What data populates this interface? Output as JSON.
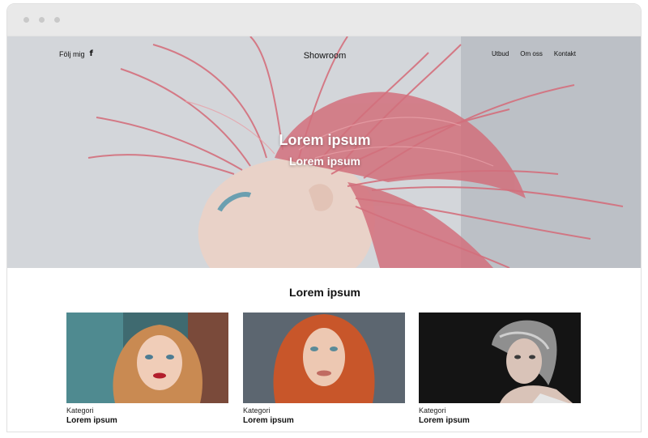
{
  "header": {
    "follow_label": "Följ mig",
    "facebook_icon": "f",
    "brand": "Showroom",
    "menu": [
      "Utbud",
      "Om oss",
      "Kontakt"
    ]
  },
  "hero": {
    "title": "Lorem ipsum",
    "subtitle": "Lorem ipsum"
  },
  "section": {
    "title": "Lorem ipsum",
    "cards": [
      {
        "category": "Kategori",
        "title": "Lorem ipsum"
      },
      {
        "category": "Kategori",
        "title": "Lorem ipsum"
      },
      {
        "category": "Kategori",
        "title": "Lorem ipsum"
      }
    ]
  },
  "colors": {
    "hair": "#d9737e",
    "text": "#111111",
    "chrome": "#e9e9e9"
  }
}
